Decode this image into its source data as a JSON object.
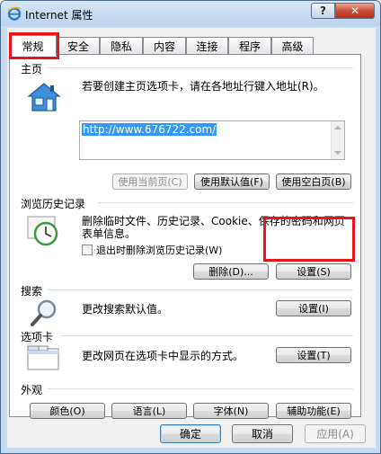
{
  "window": {
    "title": "Internet 属性",
    "help_label": "?",
    "close_label": "✕"
  },
  "tabs": [
    {
      "label": "常规",
      "active": true
    },
    {
      "label": "安全"
    },
    {
      "label": "隐私"
    },
    {
      "label": "内容"
    },
    {
      "label": "连接"
    },
    {
      "label": "程序"
    },
    {
      "label": "高级"
    }
  ],
  "home": {
    "section_title": "主页",
    "description": "若要创建主页选项卡，请在各地址行键入地址(R)。",
    "url": "http://www.676722.com/",
    "use_current_label": "使用当前页(C)",
    "use_default_label": "使用默认值(F)",
    "use_blank_label": "使用空白页(B)"
  },
  "history": {
    "section_title": "浏览历史记录",
    "description_line1": "删除临时文件、历史记录、Cookie、保存的密码和网页",
    "description_line2": "表单信息。",
    "delete_on_exit_label": "退出时删除浏览历史记录(W)",
    "delete_label": "删除(D)...",
    "settings_label": "设置(S)"
  },
  "search": {
    "section_title": "搜索",
    "description": "更改搜索默认值。",
    "settings_label": "设置(I)"
  },
  "tabs_section": {
    "section_title": "选项卡",
    "description": "更改网页在选项卡中显示的方式。",
    "settings_label": "设置(T)"
  },
  "appearance": {
    "section_title": "外观",
    "colors_label": "颜色(O)",
    "languages_label": "语言(L)",
    "fonts_label": "字体(N)",
    "accessibility_label": "辅助功能(E)"
  },
  "footer": {
    "ok_label": "确定",
    "cancel_label": "取消",
    "apply_label": "应用(A)"
  },
  "colors": {
    "highlight": "#e8141a",
    "selection": "#3399ff",
    "close_button": "#c74a32"
  }
}
